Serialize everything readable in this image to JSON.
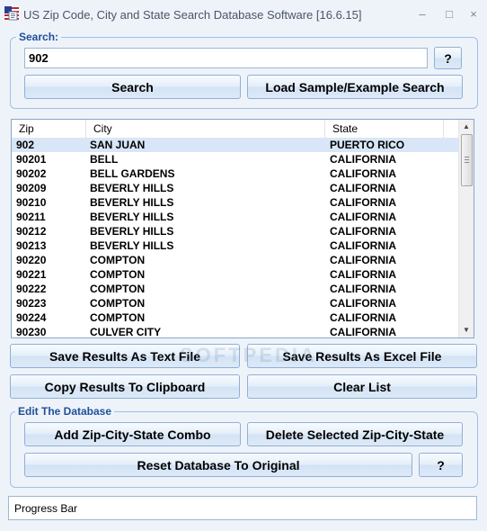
{
  "window": {
    "title": "US Zip Code, City and State Search Database Software [16.6.15]",
    "controls": {
      "minimize": "–",
      "maximize": "□",
      "close": "×"
    }
  },
  "search": {
    "group_label": "Search:",
    "input_value": "902",
    "help_label": "?",
    "search_button": "Search",
    "load_sample_button": "Load Sample/Example Search"
  },
  "results": {
    "columns": [
      "Zip",
      "City",
      "State"
    ],
    "rows": [
      [
        "902",
        "SAN JUAN",
        "PUERTO RICO"
      ],
      [
        "90201",
        "BELL",
        "CALIFORNIA"
      ],
      [
        "90202",
        "BELL GARDENS",
        "CALIFORNIA"
      ],
      [
        "90209",
        "BEVERLY HILLS",
        "CALIFORNIA"
      ],
      [
        "90210",
        "BEVERLY HILLS",
        "CALIFORNIA"
      ],
      [
        "90211",
        "BEVERLY HILLS",
        "CALIFORNIA"
      ],
      [
        "90212",
        "BEVERLY HILLS",
        "CALIFORNIA"
      ],
      [
        "90213",
        "BEVERLY HILLS",
        "CALIFORNIA"
      ],
      [
        "90220",
        "COMPTON",
        "CALIFORNIA"
      ],
      [
        "90221",
        "COMPTON",
        "CALIFORNIA"
      ],
      [
        "90222",
        "COMPTON",
        "CALIFORNIA"
      ],
      [
        "90223",
        "COMPTON",
        "CALIFORNIA"
      ],
      [
        "90224",
        "COMPTON",
        "CALIFORNIA"
      ],
      [
        "90230",
        "CULVER CITY",
        "CALIFORNIA"
      ]
    ],
    "selected_row": 0,
    "scroll_up_glyph": "▲",
    "scroll_down_glyph": "▼"
  },
  "actions": {
    "save_text": "Save Results As Text File",
    "save_excel": "Save Results As Excel File",
    "copy_clipboard": "Copy Results To Clipboard",
    "clear_list": "Clear List"
  },
  "edit_db": {
    "group_label": "Edit The Database",
    "add_combo": "Add Zip-City-State Combo",
    "delete_selected": "Delete Selected Zip-City-State",
    "reset": "Reset Database To Original",
    "help_label": "?"
  },
  "progress": {
    "label": "Progress Bar"
  },
  "watermark": "SOFTPEDIA",
  "icons": {
    "app": "flag-icon"
  }
}
